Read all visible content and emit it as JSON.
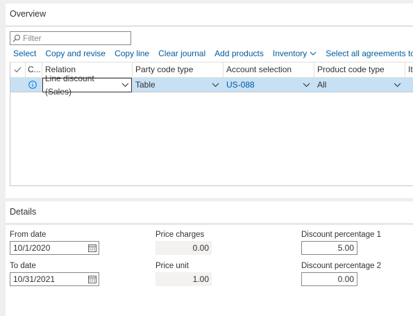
{
  "overview": {
    "title": "Overview",
    "filter_placeholder": "Filter",
    "actions": [
      "Select",
      "Copy and revise",
      "Copy line",
      "Clear journal",
      "Add products",
      "Inventory",
      "Select all agreements to b"
    ],
    "grid": {
      "columns": [
        "C...",
        "Relation",
        "Party code type",
        "Account selection",
        "Product code type",
        "Ite"
      ],
      "row": {
        "relation": "Line discount (Sales)",
        "party_code_type": "Table",
        "account_selection": "US-088",
        "product_code_type": "All"
      }
    }
  },
  "details": {
    "title": "Details",
    "from_date_label": "From date",
    "from_date": "10/1/2020",
    "to_date_label": "To date",
    "to_date": "10/31/2021",
    "price_charges_label": "Price charges",
    "price_charges": "0.00",
    "price_unit_label": "Price unit",
    "price_unit": "1.00",
    "discount1_label": "Discount percentage 1",
    "discount1": "5.00",
    "discount2_label": "Discount percentage 2",
    "discount2": "0.00"
  },
  "colors": {
    "link": "#005a9e",
    "selected_row": "#c7e0f4",
    "info_icon": "#0078d4"
  },
  "icons": [
    "search-icon",
    "chevron-down-icon",
    "checkmark-icon",
    "info-icon",
    "calendar-icon"
  ]
}
